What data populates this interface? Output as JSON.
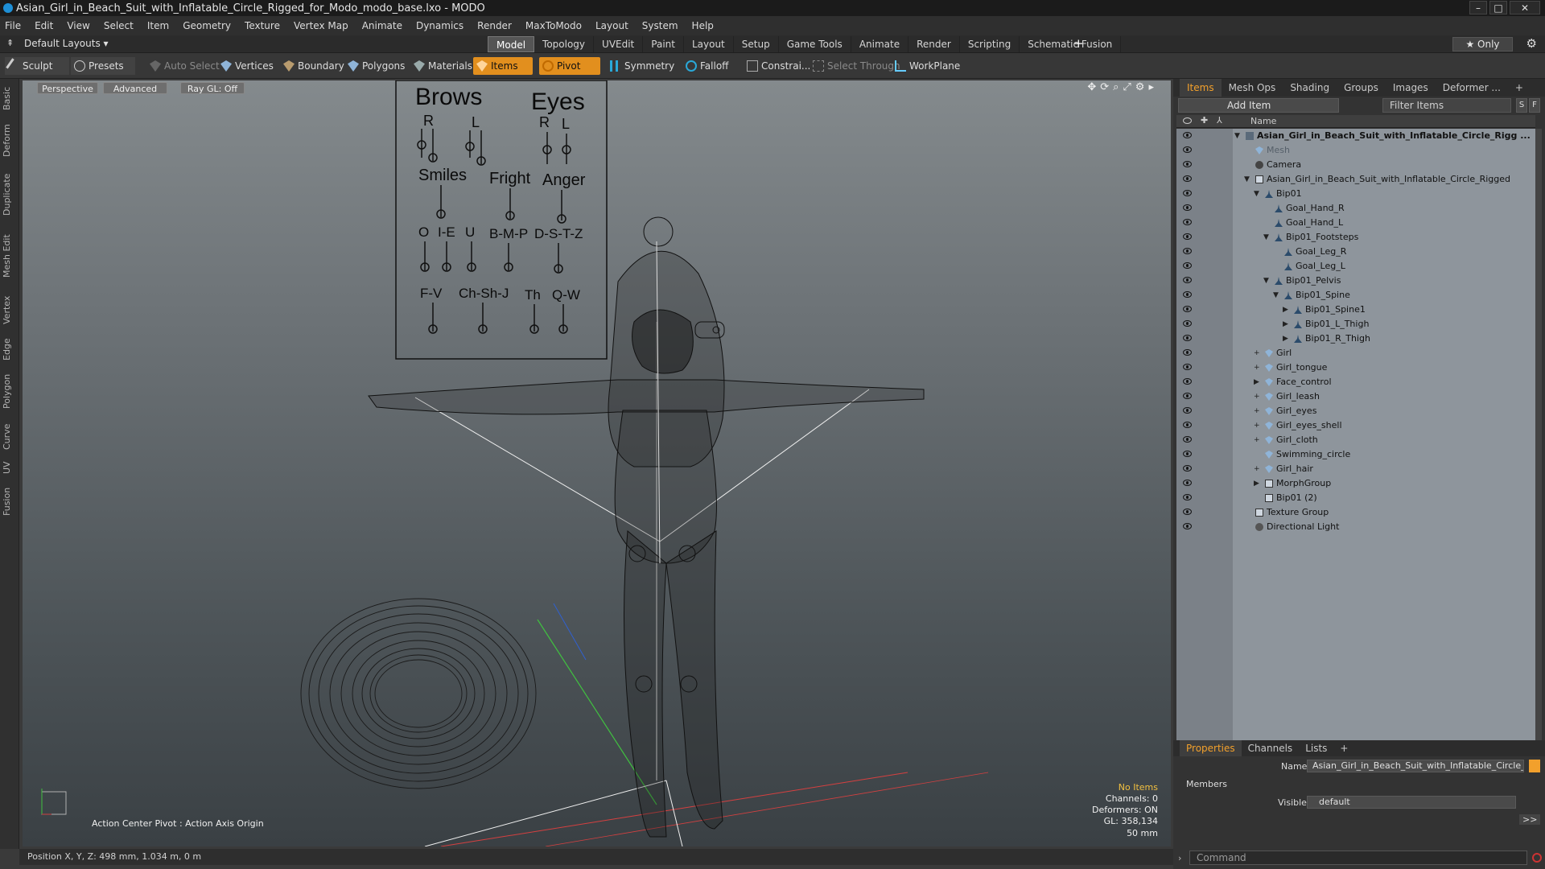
{
  "window": {
    "title": "Asian_Girl_in_Beach_Suit_with_Inflatable_Circle_Rigged_for_Modo_modo_base.lxo - MODO"
  },
  "menu": [
    "File",
    "Edit",
    "View",
    "Select",
    "Item",
    "Geometry",
    "Texture",
    "Vertex Map",
    "Animate",
    "Dynamics",
    "Render",
    "MaxToModo",
    "Layout",
    "System",
    "Help"
  ],
  "layout": {
    "selector": "Default Layouts ▾",
    "tabs": [
      "Model",
      "Topology",
      "UVEdit",
      "Paint",
      "Layout",
      "Setup",
      "Game Tools",
      "Animate",
      "Render",
      "Scripting",
      "Schematic Fusion"
    ],
    "active_tab": "Model",
    "add": "+",
    "only": "★ Only"
  },
  "toolbar": {
    "sculpt": "Sculpt",
    "presets": "Presets",
    "auto_select": "Auto Select",
    "vertices": "Vertices",
    "boundary": "Boundary",
    "polygons": "Polygons",
    "materials": "Materials",
    "items": "Items",
    "pivot": "Pivot",
    "symmetry": "Symmetry",
    "falloff": "Falloff",
    "constraints": "Constrai...",
    "select_through": "Select Through",
    "workplane": "WorkPlane"
  },
  "left_tabs": [
    "Basic",
    "Deform",
    "Duplicate",
    "Mesh Edit",
    "Vertex",
    "Edge",
    "Polygon",
    "Curve",
    "UV",
    "Fusion"
  ],
  "viewport": {
    "view": "Perspective",
    "shading": "Advanced",
    "raygl": "Ray GL: Off",
    "action_center": "Action Center Pivot : Action Axis Origin",
    "hud": {
      "no_items": "No Items",
      "channels": "Channels: 0",
      "deformers": "Deformers: ON",
      "gl": "GL: 358,134",
      "size": "50 mm"
    },
    "face_board": {
      "brows": "Brows",
      "eyes": "Eyes",
      "r": "R",
      "l": "L",
      "smiles": "Smiles",
      "fright": "Fright",
      "anger": "Anger",
      "o": "O",
      "ie": "I-E",
      "u": "U",
      "bmp": "B-M-P",
      "dstz": "D-S-T-Z",
      "fv": "F-V",
      "chshj": "Ch-Sh-J",
      "th": "Th",
      "qw": "Q-W"
    }
  },
  "statusbar": {
    "position": "Position X, Y, Z:  498 mm, 1.034 m, 0 m"
  },
  "items_panel": {
    "tabs": [
      "Items",
      "Mesh Ops",
      "Shading",
      "Groups",
      "Images",
      "Deformer ..."
    ],
    "active": "Items",
    "add": "+",
    "add_item": "Add Item",
    "filter": "Filter Items",
    "column": "Name",
    "rows": [
      {
        "label": "Asian_Girl_in_Beach_Suit_with_Inflatable_Circle_Rigg ...",
        "indent": 0,
        "arrow": "▼",
        "bold": true,
        "icon": "scene"
      },
      {
        "label": "Mesh",
        "indent": 1,
        "arrow": "",
        "dim": true,
        "icon": "mesh"
      },
      {
        "label": "Camera",
        "indent": 1,
        "arrow": "",
        "icon": "camera"
      },
      {
        "label": "Asian_Girl_in_Beach_Suit_with_Inflatable_Circle_Rigged",
        "indent": 1,
        "arrow": "▼",
        "icon": "group"
      },
      {
        "label": "Bip01",
        "indent": 2,
        "arrow": "▼",
        "icon": "bone"
      },
      {
        "label": "Goal_Hand_R",
        "indent": 3,
        "arrow": "",
        "icon": "bone"
      },
      {
        "label": "Goal_Hand_L",
        "indent": 3,
        "arrow": "",
        "icon": "bone"
      },
      {
        "label": "Bip01_Footsteps",
        "indent": 3,
        "arrow": "▼",
        "icon": "bone"
      },
      {
        "label": "Goal_Leg_R",
        "indent": 4,
        "arrow": "",
        "icon": "bone"
      },
      {
        "label": "Goal_Leg_L",
        "indent": 4,
        "arrow": "",
        "icon": "bone"
      },
      {
        "label": "Bip01_Pelvis",
        "indent": 3,
        "arrow": "▼",
        "icon": "bone"
      },
      {
        "label": "Bip01_Spine",
        "indent": 4,
        "arrow": "▼",
        "icon": "bone"
      },
      {
        "label": "Bip01_Spine1",
        "indent": 5,
        "arrow": "▶",
        "icon": "bone"
      },
      {
        "label": "Bip01_L_Thigh",
        "indent": 5,
        "arrow": "▶",
        "icon": "bone"
      },
      {
        "label": "Bip01_R_Thigh",
        "indent": 5,
        "arrow": "▶",
        "icon": "bone"
      },
      {
        "label": "Girl",
        "indent": 2,
        "arrow": "+",
        "icon": "mesh"
      },
      {
        "label": "Girl_tongue",
        "indent": 2,
        "arrow": "+",
        "icon": "mesh"
      },
      {
        "label": "Face_control",
        "indent": 2,
        "arrow": "▶",
        "icon": "mesh"
      },
      {
        "label": "Girl_leash",
        "indent": 2,
        "arrow": "+",
        "icon": "mesh"
      },
      {
        "label": "Girl_eyes",
        "indent": 2,
        "arrow": "+",
        "icon": "mesh"
      },
      {
        "label": "Girl_eyes_shell",
        "indent": 2,
        "arrow": "+",
        "icon": "mesh"
      },
      {
        "label": "Girl_cloth",
        "indent": 2,
        "arrow": "+",
        "icon": "mesh"
      },
      {
        "label": "Swimming_circle",
        "indent": 2,
        "arrow": "",
        "icon": "mesh"
      },
      {
        "label": "Girl_hair",
        "indent": 2,
        "arrow": "+",
        "icon": "mesh"
      },
      {
        "label": "MorphGroup",
        "indent": 2,
        "arrow": "▶",
        "icon": "group"
      },
      {
        "label": "Bip01 (2)",
        "indent": 2,
        "arrow": "",
        "icon": "group"
      },
      {
        "label": "Texture Group",
        "indent": 1,
        "arrow": "",
        "icon": "group"
      },
      {
        "label": "Directional Light",
        "indent": 1,
        "arrow": "",
        "icon": "light"
      }
    ]
  },
  "properties": {
    "tabs": [
      "Properties",
      "Channels",
      "Lists"
    ],
    "active": "Properties",
    "add": "+",
    "name_label": "Name",
    "name_value": "Asian_Girl_in_Beach_Suit_with_Inflatable_Circle_Rigg",
    "members": "Members",
    "visible_label": "Visible",
    "visible_value": "default",
    "more": ">>"
  },
  "command": {
    "placeholder": "Command"
  },
  "colors": {
    "accent": "#f2a02c",
    "orange_btn": "#e28f1e"
  }
}
